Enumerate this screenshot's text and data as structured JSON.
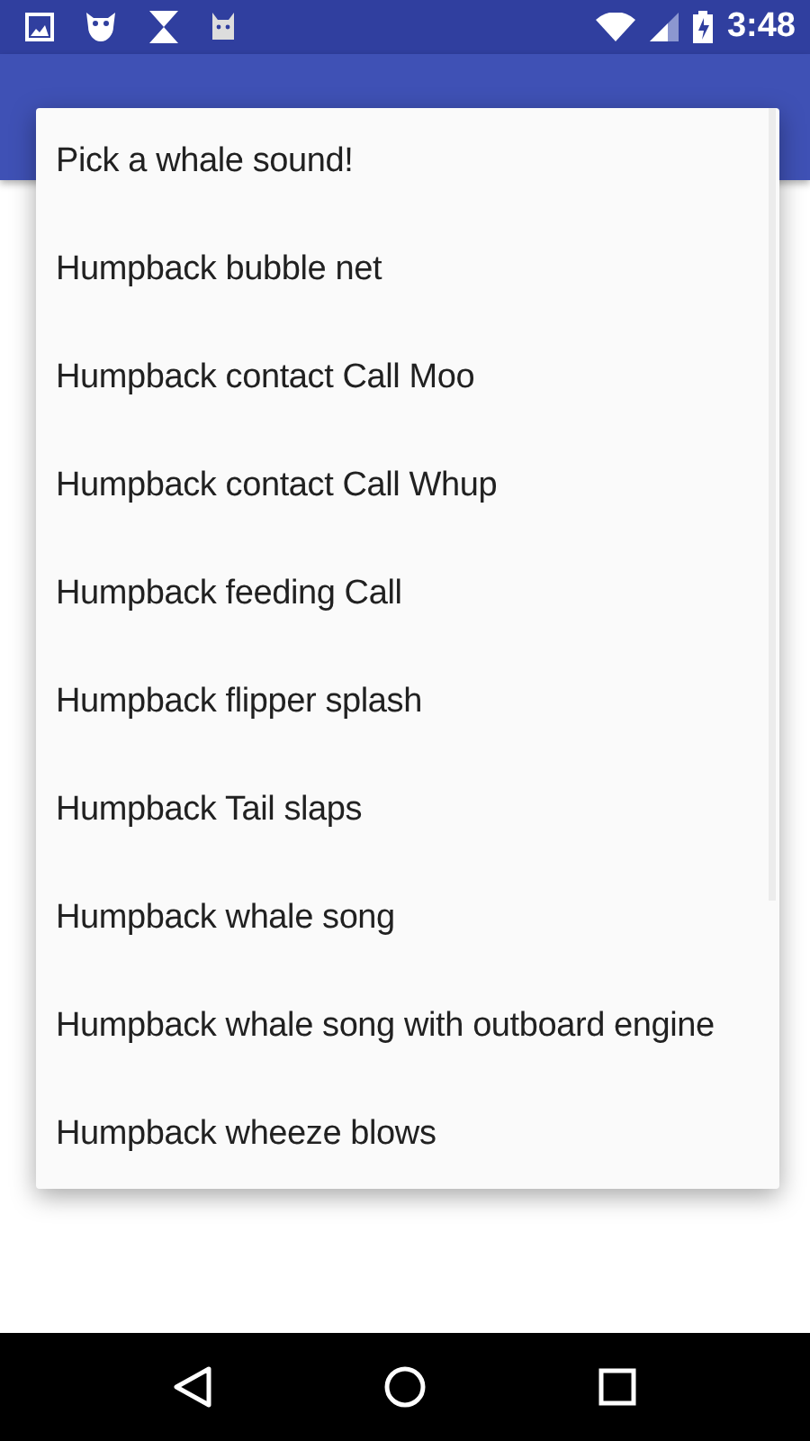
{
  "status_bar": {
    "time": "3:48"
  },
  "dropdown": {
    "items": [
      {
        "label": "Pick a whale sound!"
      },
      {
        "label": "Humpback bubble net"
      },
      {
        "label": "Humpback contact Call Moo"
      },
      {
        "label": "Humpback contact Call Whup"
      },
      {
        "label": "Humpback feeding Call"
      },
      {
        "label": "Humpback flipper splash"
      },
      {
        "label": "Humpback Tail slaps"
      },
      {
        "label": "Humpback whale song"
      },
      {
        "label": "Humpback whale song with outboard engine"
      },
      {
        "label": "Humpback wheeze blows"
      }
    ]
  }
}
